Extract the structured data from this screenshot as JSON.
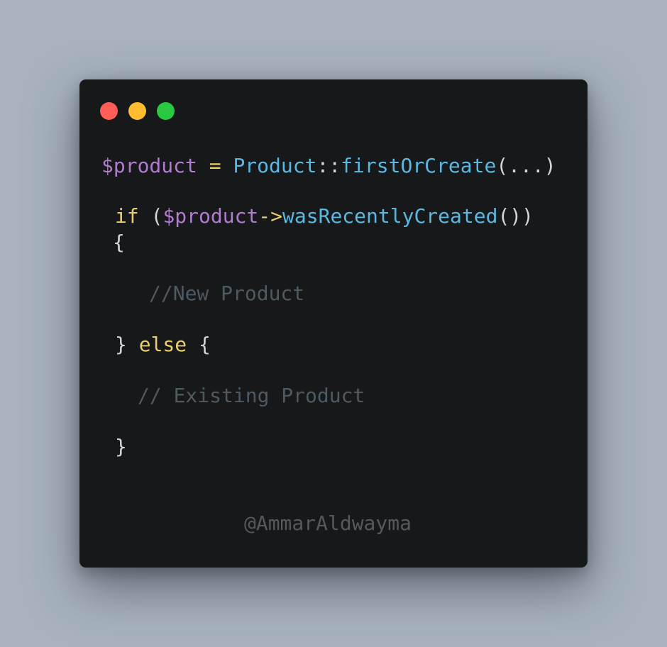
{
  "window": {
    "controls": {
      "close_color": "#ff5f57",
      "minimize_color": "#febc2e",
      "maximize_color": "#28c840"
    }
  },
  "code": {
    "line1": {
      "var": "$product",
      "assign": " = ",
      "class": "Product",
      "scope": "::",
      "method": "firstOrCreate",
      "args": "(...)"
    },
    "line2": {
      "keyword": "if",
      "open": " (",
      "var": "$product",
      "arrow": "->",
      "method": "wasRecentlyCreated",
      "close": "())"
    },
    "line3": {
      "brace": "{"
    },
    "line4": {
      "comment": "//New Product"
    },
    "line5": {
      "close_brace": "}",
      "keyword": " else",
      "open_brace": " {"
    },
    "line6": {
      "comment": "// Existing Product"
    },
    "line7": {
      "brace": "}"
    }
  },
  "footer": {
    "handle": "@AmmarAldwayma"
  },
  "colors": {
    "background": "#a8b3bf",
    "editor": "#17181a",
    "variable": "#b07ccf",
    "keyword": "#e9cd6f",
    "function": "#5bb8e0",
    "comment": "#4e5a61"
  }
}
